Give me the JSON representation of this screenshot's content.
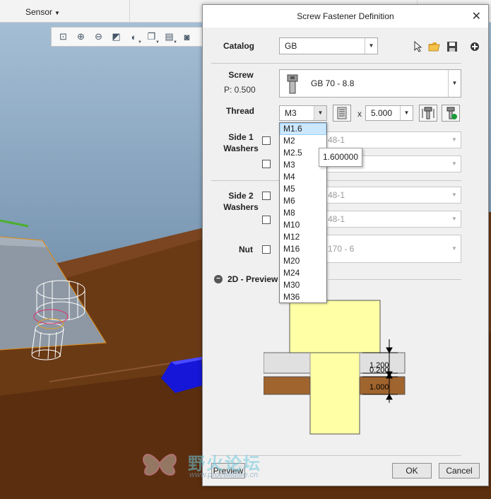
{
  "app": {
    "sensor_label": "Sensor"
  },
  "view_toolbar": {
    "icons": [
      "zoom-fit-icon",
      "zoom-in-icon",
      "zoom-out-icon",
      "repaint-icon",
      "display-style-icon",
      "view-orientation-icon",
      "saved-views-icon",
      "datum-display-icon"
    ]
  },
  "dialog": {
    "title": "Screw Fastener Definition",
    "catalog": {
      "label": "Catalog",
      "value": "GB"
    },
    "screw": {
      "label": "Screw",
      "pitch_label": "P: 0.500",
      "value": "GB 70 - 8.8"
    },
    "thread": {
      "label": "Thread",
      "value": "M3",
      "multiply": "x",
      "length": "5.000",
      "options": [
        "M1.6",
        "M2",
        "M2.5",
        "M3",
        "M4",
        "M5",
        "M6",
        "M8",
        "M10",
        "M12",
        "M16",
        "M20",
        "M24",
        "M30",
        "M36"
      ],
      "highlighted": "M1.6",
      "tooltip": "1.600000"
    },
    "side1": {
      "label_line1": "Side 1",
      "label_line2": "Washers",
      "washer1": "48-1",
      "washer2": ""
    },
    "side2": {
      "label_line1": "Side 2",
      "label_line2": "Washers",
      "washer1": "48-1",
      "washer2": "48-1"
    },
    "nut": {
      "label": "Nut",
      "value": "170 - 6"
    },
    "preview_section": {
      "label": "2D - Preview",
      "dims": {
        "washer": "1.200",
        "gap": "0.200",
        "plate": "1.000"
      }
    },
    "buttons": {
      "preview": "Preview",
      "ok": "OK",
      "cancel": "Cancel"
    }
  },
  "watermark": {
    "cn": "野火论坛",
    "url": "www.proewildfire.cn"
  },
  "colors": {
    "background_blue": "#7d99b3",
    "plate_brown": "#6b3a16",
    "part_gray": "#8f9aa6",
    "preview_yellow": "#ffffa6",
    "block_blue": "#1414d8"
  }
}
